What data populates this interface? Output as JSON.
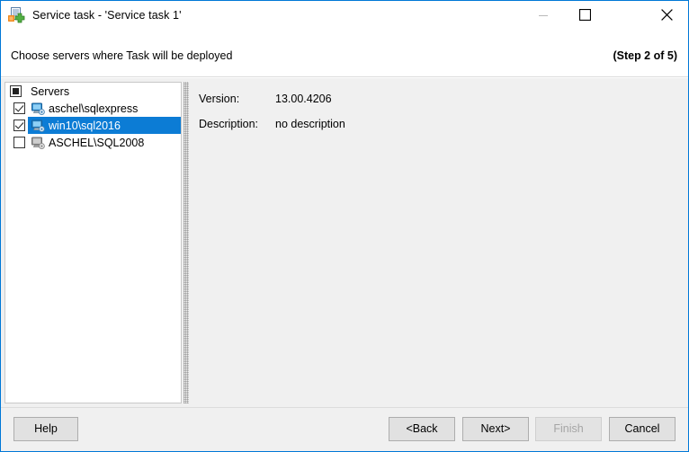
{
  "window": {
    "title": "Service task - 'Service task 1'",
    "icon": "service-task-icon",
    "accent_color": "#0078d7",
    "controls": {
      "minimize": "minimize-icon",
      "maximize": "maximize-icon",
      "close": "close-icon"
    }
  },
  "header": {
    "subtitle": "Choose servers where Task will be deployed",
    "step": "(Step 2 of 5)"
  },
  "server_list": {
    "header_label": "Servers",
    "header_checkbox_state": "indeterminate",
    "selection_color": "#0c7cd5",
    "rows": [
      {
        "name": "aschel\\sqlexpress",
        "checked": true,
        "selected": false,
        "icon": "server-icon",
        "enabled": true
      },
      {
        "name": "win10\\sql2016",
        "checked": true,
        "selected": true,
        "icon": "server-icon",
        "enabled": true
      },
      {
        "name": "ASCHEL\\SQL2008",
        "checked": false,
        "selected": false,
        "icon": "server-icon-disabled",
        "enabled": false
      }
    ]
  },
  "details": {
    "version_label": "Version:",
    "version_value": "13.00.4206",
    "description_label": "Description:",
    "description_value": "no description"
  },
  "footer": {
    "help": "Help",
    "back": "<Back",
    "next": "Next>",
    "finish": "Finish",
    "cancel": "Cancel"
  }
}
